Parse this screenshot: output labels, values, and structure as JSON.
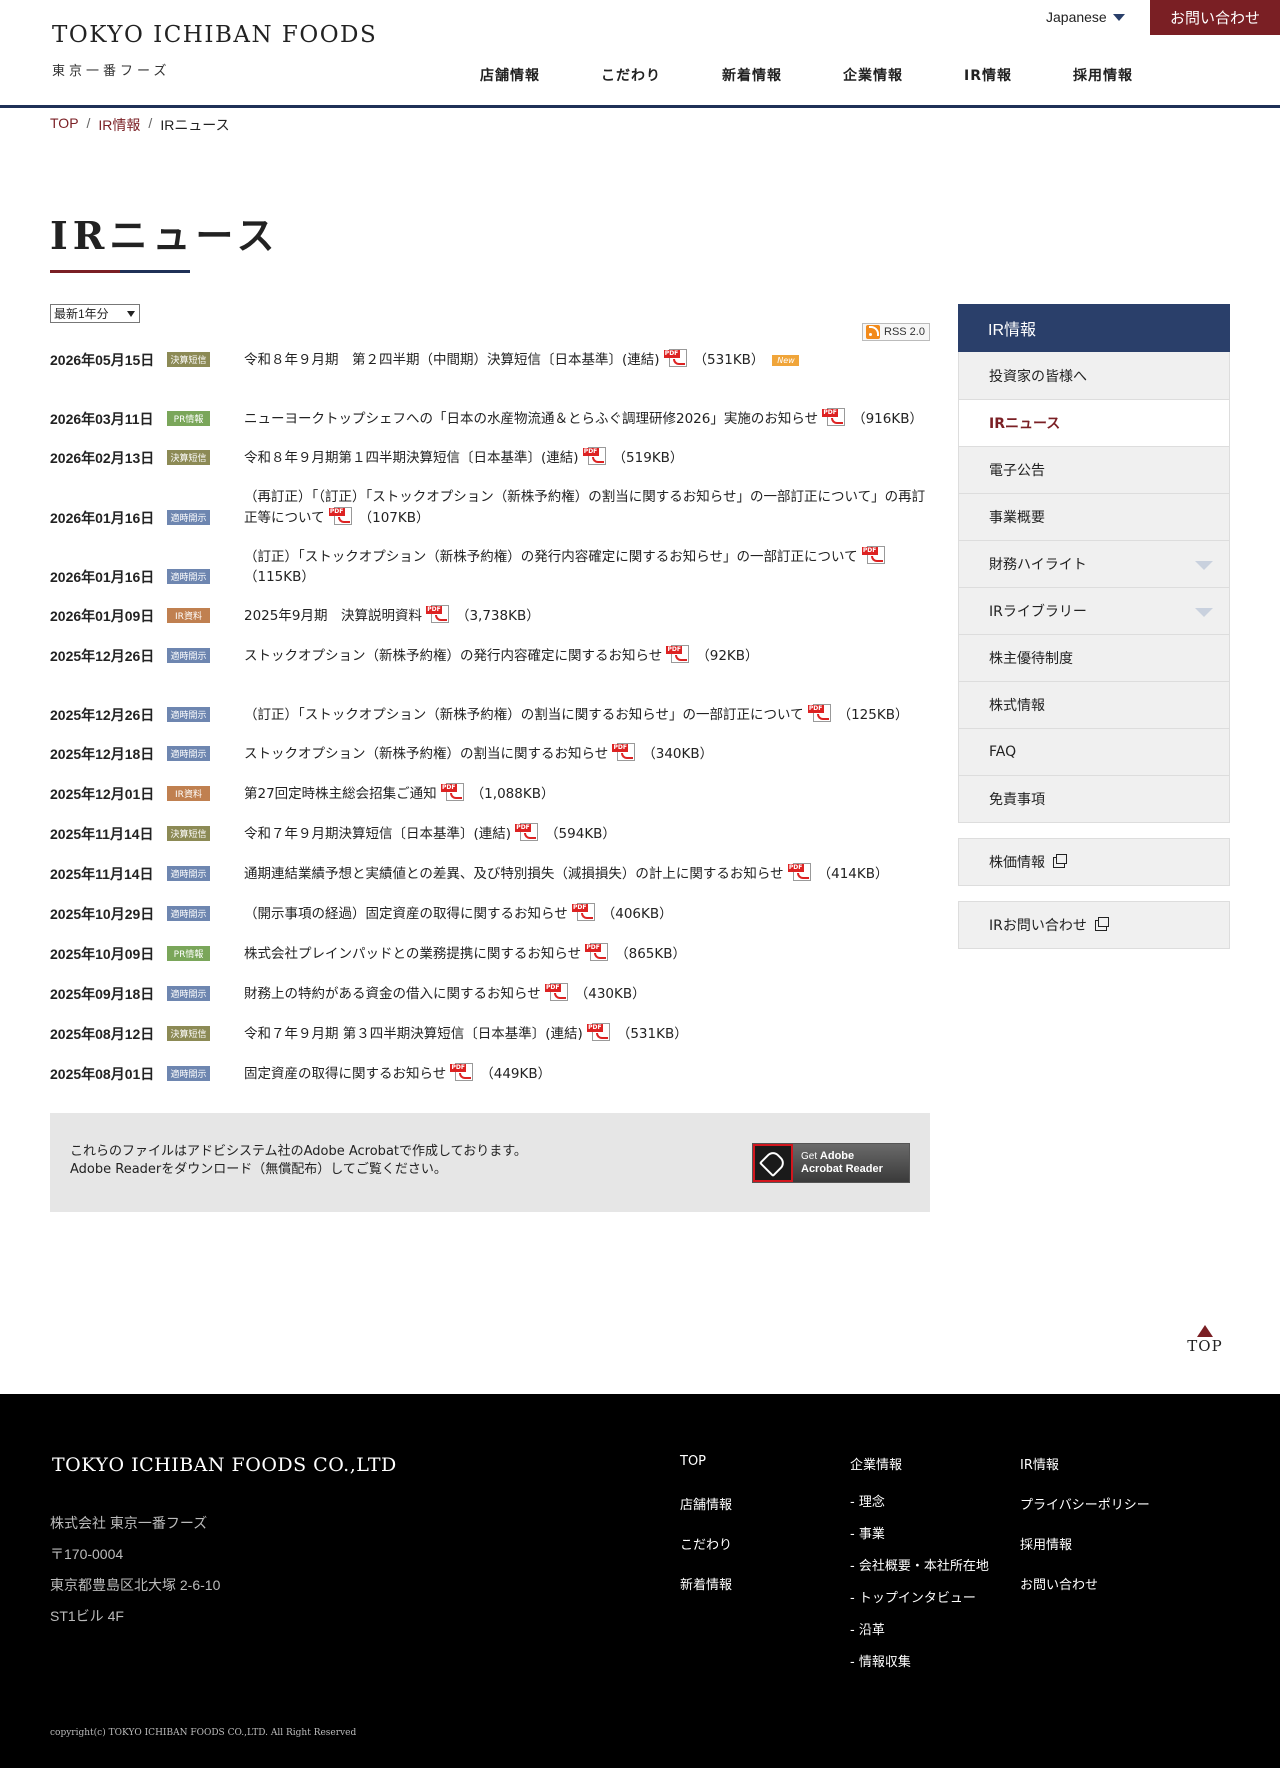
{
  "header": {
    "logo_en": "TOKYO ICHIBAN FOODS",
    "logo_jp": "東京一番フーズ",
    "language": "Japanese",
    "contact": "お問い合わせ",
    "nav": [
      "店舗情報",
      "こだわり",
      "新着情報",
      "企業情報",
      "IR情報",
      "採用情報"
    ]
  },
  "breadcrumb": {
    "top": "TOP",
    "ir": "IR情報",
    "current": "IRニュース"
  },
  "page_title": "IRニュース",
  "year_select": "最新1年分",
  "rss": "RSS 2.0",
  "pdf_label": "PDF",
  "new_label": "New",
  "news": [
    {
      "date": "2026年05月15日",
      "category": "決算短信",
      "title": "令和８年９月期　第２四半期（中間期）決算短信〔日本基準〕(連結)",
      "size": "（531KB）",
      "new": true
    },
    {
      "date": "2026年03月11日",
      "category": "PR情報",
      "title": "ニューヨークトップシェフへの「日本の水産物流通＆とらふぐ調理研修2026」実施のお知らせ",
      "size": "（916KB）"
    },
    {
      "date": "2026年02月13日",
      "category": "決算短信",
      "title": "令和８年９月期第１四半期決算短信〔日本基準〕(連結)",
      "size": "（519KB）"
    },
    {
      "date": "2026年01月16日",
      "category": "適時開示",
      "title": "（再訂正）「（訂正）「ストックオプション（新株予約権）の割当に関するお知らせ」の一部訂正について」の再訂正等について",
      "size": "（107KB）"
    },
    {
      "date": "2026年01月16日",
      "category": "適時開示",
      "title": "（訂正）「ストックオプション（新株予約権）の発行内容確定に関するお知らせ」の一部訂正について",
      "size": "（115KB）"
    },
    {
      "date": "2026年01月09日",
      "category": "IR資料",
      "title": "2025年9月期　決算説明資料",
      "size": "（3,738KB）"
    },
    {
      "date": "2025年12月26日",
      "category": "適時開示",
      "title": "ストックオプション（新株予約権）の発行内容確定に関するお知らせ",
      "size": "（92KB）"
    },
    {
      "date": "2025年12月26日",
      "category": "適時開示",
      "title": "（訂正）「ストックオプション（新株予約権）の割当に関するお知らせ」の一部訂正について",
      "size": "（125KB）"
    },
    {
      "date": "2025年12月18日",
      "category": "適時開示",
      "title": "ストックオプション（新株予約権）の割当に関するお知らせ",
      "size": "（340KB）"
    },
    {
      "date": "2025年12月01日",
      "category": "IR資料",
      "title": "第27回定時株主総会招集ご通知",
      "size": "（1,088KB）"
    },
    {
      "date": "2025年11月14日",
      "category": "決算短信",
      "title": "令和７年９月期決算短信〔日本基準〕(連結)",
      "size": "（594KB）"
    },
    {
      "date": "2025年11月14日",
      "category": "適時開示",
      "title": "通期連結業績予想と実績値との差異、及び特別損失（減損損失）の計上に関するお知らせ",
      "size": "（414KB）"
    },
    {
      "date": "2025年10月29日",
      "category": "適時開示",
      "title": "（開示事項の経過）固定資産の取得に関するお知らせ",
      "size": "（406KB）"
    },
    {
      "date": "2025年10月09日",
      "category": "PR情報",
      "title": "株式会社プレインパッドとの業務提携に関するお知らせ",
      "size": "（865KB）"
    },
    {
      "date": "2025年09月18日",
      "category": "適時開示",
      "title": "財務上の特約がある資金の借入に関するお知らせ",
      "size": "（430KB）"
    },
    {
      "date": "2025年08月12日",
      "category": "決算短信",
      "title": "令和７年９月期 第３四半期決算短信〔日本基準〕(連結)",
      "size": "（531KB）"
    },
    {
      "date": "2025年08月01日",
      "category": "適時開示",
      "title": "固定資産の取得に関するお知らせ",
      "size": "（449KB）"
    }
  ],
  "category_colors": {
    "決算短信": "#8c8a55",
    "PR情報": "#7aa65a",
    "適時開示": "#6e86b0",
    "IR資料": "#c08050"
  },
  "adobe": {
    "line1": "これらのファイルはアドビシステム社のAdobe Acrobatで作成しております。",
    "line2": "Adobe Readerをダウンロード（無償配布）してご覧ください。",
    "btn_get": "Get",
    "btn_adobe": "Adobe",
    "btn_product": "Acrobat Reader"
  },
  "sidebar": {
    "heading": "IR情報",
    "items": [
      {
        "label": "投資家の皆様へ"
      },
      {
        "label": "IRニュース",
        "current": true
      },
      {
        "label": "電子公告"
      },
      {
        "label": "事業概要"
      },
      {
        "label": "財務ハイライト",
        "expandable": true
      },
      {
        "label": "IRライブラリー",
        "expandable": true
      },
      {
        "label": "株主優待制度"
      },
      {
        "label": "株式情報"
      },
      {
        "label": "FAQ"
      },
      {
        "label": "免責事項"
      }
    ],
    "stock": "株価情報",
    "ir_contact": "IRお問い合わせ"
  },
  "to_top": "TOP",
  "footer": {
    "logo": "TOKYO ICHIBAN FOODS CO.,LTD",
    "address": [
      "株式会社 東京一番フーズ",
      "〒170-0004",
      "東京都豊島区北大塚 2-6-10",
      "ST1ビル 4F"
    ],
    "col1": [
      "TOP",
      "店舗情報",
      "こだわり",
      "新着情報"
    ],
    "col2": [
      "企業情報",
      "- 理念",
      "- 事業",
      "- 会社概要・本社所在地",
      "- トップインタビュー",
      "- 沿革",
      "- 情報収集"
    ],
    "col3": [
      "IR情報",
      "プライバシーポリシー",
      "採用情報",
      "お問い合わせ"
    ],
    "copyright": "copyright(c) TOKYO ICHIBAN FOODS CO.,LTD. All Right Reserved"
  },
  "colors": {
    "brand_red": "#7a1f24",
    "brand_navy": "#1f3157",
    "sidebar_head": "#2a3f6a"
  }
}
